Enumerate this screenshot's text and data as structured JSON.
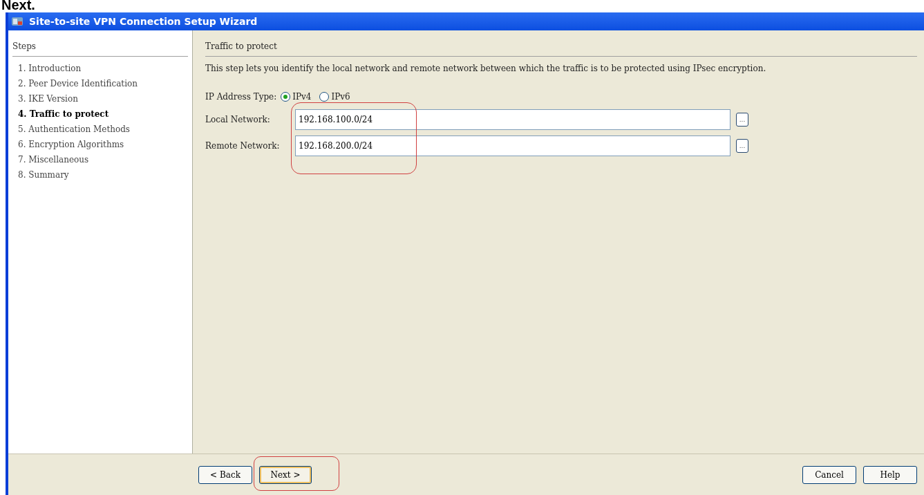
{
  "caption": "Next.",
  "window": {
    "title": "Site-to-site VPN Connection Setup Wizard"
  },
  "steps": {
    "heading": "Steps",
    "items": [
      {
        "label": "1. Introduction",
        "selected": false
      },
      {
        "label": "2. Peer Device Identification",
        "selected": false
      },
      {
        "label": "3. IKE Version",
        "selected": false
      },
      {
        "label": "4. Traffic to protect",
        "selected": true
      },
      {
        "label": "5. Authentication Methods",
        "selected": false
      },
      {
        "label": "6. Encryption Algorithms",
        "selected": false
      },
      {
        "label": "7. Miscellaneous",
        "selected": false
      },
      {
        "label": "8. Summary",
        "selected": false
      }
    ]
  },
  "page": {
    "heading": "Traffic to protect",
    "description": "This step lets you identify the local network and remote network between which the traffic is to be protected using IPsec encryption.",
    "address_type": {
      "label": "IP Address Type:",
      "options": [
        {
          "label": "IPv4",
          "selected": true
        },
        {
          "label": "IPv6",
          "selected": false
        }
      ]
    },
    "fields_highlighted": true,
    "fields": [
      {
        "label": "Local Network:",
        "value": "192.168.100.0/24",
        "browse": "..."
      },
      {
        "label": "Remote Network:",
        "value": "192.168.200.0/24",
        "browse": "..."
      }
    ]
  },
  "buttons": {
    "left": [
      {
        "label": "< Back",
        "highlighted": false
      },
      {
        "label": "Next >",
        "highlighted": true
      }
    ],
    "right": [
      {
        "label": "Cancel",
        "highlighted": false
      },
      {
        "label": "Help",
        "highlighted": false
      }
    ]
  }
}
